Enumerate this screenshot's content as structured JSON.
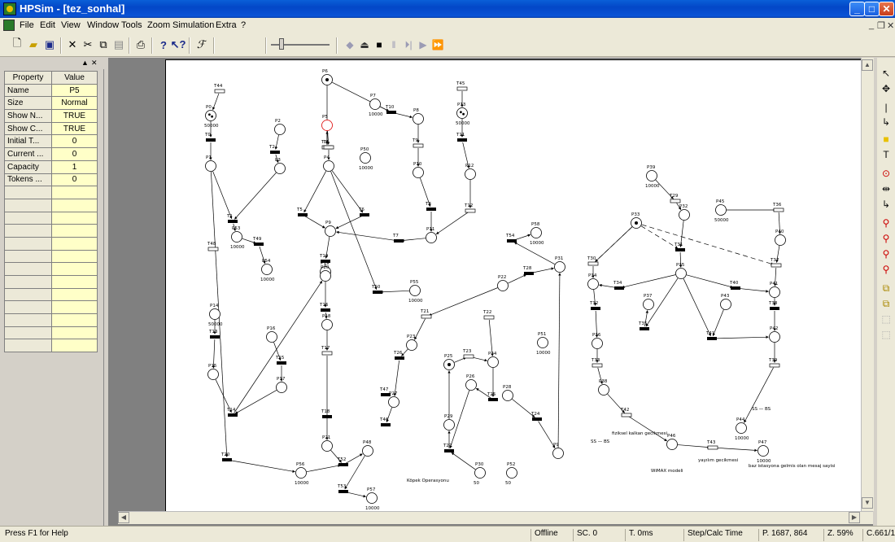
{
  "window": {
    "title": "HPSim - [tez_sonhal]"
  },
  "menu": {
    "items": [
      "File",
      "Edit",
      "View",
      "Window",
      "Tools",
      "Zoom",
      "Simulation",
      "Extra",
      "?"
    ]
  },
  "properties": {
    "col_property": "Property",
    "col_value": "Value",
    "rows": [
      {
        "name": "Name",
        "value": "P5"
      },
      {
        "name": "Size",
        "value": "Normal"
      },
      {
        "name": "Show N...",
        "value": "TRUE"
      },
      {
        "name": "Show C...",
        "value": "TRUE"
      },
      {
        "name": "Initial T...",
        "value": "0"
      },
      {
        "name": "Current ...",
        "value": "0"
      },
      {
        "name": "Capacity",
        "value": "1"
      },
      {
        "name": "Tokens ...",
        "value": "0"
      }
    ]
  },
  "net": {
    "places": [
      {
        "id": "P6",
        "tokens": 1,
        "label": "P6"
      },
      {
        "id": "P0",
        "label": "P0",
        "cap": "50000",
        "tokens": 2
      },
      {
        "id": "P1",
        "label": "P1"
      },
      {
        "id": "P2",
        "label": "P2"
      },
      {
        "id": "P3",
        "label": "P3"
      },
      {
        "id": "P4",
        "label": "P4"
      },
      {
        "id": "P5",
        "label": "P5",
        "selected": true
      },
      {
        "id": "P7",
        "label": "P7",
        "cap": "10000"
      },
      {
        "id": "P8",
        "label": "P8"
      },
      {
        "id": "P9",
        "label": "P9"
      },
      {
        "id": "P10",
        "label": "P10"
      },
      {
        "id": "P11",
        "label": "P11"
      },
      {
        "id": "P12",
        "label": "P12"
      },
      {
        "id": "P13",
        "label": "P13",
        "cap": "50000",
        "tokens": 2
      },
      {
        "id": "P50",
        "label": "P50",
        "cap": "10000"
      },
      {
        "id": "P53",
        "label": "P53",
        "cap": "10000"
      },
      {
        "id": "P54",
        "label": "P54",
        "cap": "10000"
      },
      {
        "id": "P55",
        "label": "P55",
        "cap": "10000"
      },
      {
        "id": "P58",
        "label": "P58",
        "cap": "10000"
      },
      {
        "id": "P19",
        "label": "P19"
      },
      {
        "id": "P20",
        "label": "P20"
      },
      {
        "id": "P14",
        "label": "P14",
        "cap": "50000"
      },
      {
        "id": "P15",
        "label": "P15"
      },
      {
        "id": "P16",
        "label": "P16"
      },
      {
        "id": "P17",
        "label": "P17"
      },
      {
        "id": "P18",
        "label": "P18"
      },
      {
        "id": "P21",
        "label": "P21"
      },
      {
        "id": "P22",
        "label": "P22"
      },
      {
        "id": "P31",
        "label": "P31"
      },
      {
        "id": "P23",
        "label": "P23"
      },
      {
        "id": "P25",
        "label": "P25",
        "tokens": 1
      },
      {
        "id": "P24",
        "label": "P24"
      },
      {
        "id": "P26",
        "label": "P26"
      },
      {
        "id": "P27",
        "label": "P27"
      },
      {
        "id": "P28",
        "label": "P28"
      },
      {
        "id": "P29",
        "label": "P29"
      },
      {
        "id": "P30",
        "label": "P30",
        "cap": "50"
      },
      {
        "id": "P51",
        "label": "P51",
        "cap": "10000"
      },
      {
        "id": "P52",
        "label": "P52",
        "cap": "50"
      },
      {
        "id": "P48",
        "label": "P48"
      },
      {
        "id": "P56",
        "label": "P56",
        "cap": "10000"
      },
      {
        "id": "P57",
        "label": "P57",
        "cap": "10000"
      },
      {
        "id": "P9b",
        "label": "P9"
      },
      {
        "id": "P33",
        "label": "P33",
        "tokens": 1
      },
      {
        "id": "P39",
        "label": "P39",
        "cap": "10000"
      },
      {
        "id": "P45",
        "label": "P45",
        "cap": "50000"
      },
      {
        "id": "P32",
        "label": "P32"
      },
      {
        "id": "P35",
        "label": "P35"
      },
      {
        "id": "P34",
        "label": "P34"
      },
      {
        "id": "P37",
        "label": "P37"
      },
      {
        "id": "P36",
        "label": "P36"
      },
      {
        "id": "P38",
        "label": "P38"
      },
      {
        "id": "P40",
        "label": "P40"
      },
      {
        "id": "P41",
        "label": "P41"
      },
      {
        "id": "P42",
        "label": "P42"
      },
      {
        "id": "P43",
        "label": "P43"
      },
      {
        "id": "P44",
        "label": "P44",
        "cap": "10000"
      },
      {
        "id": "P46",
        "label": "P46"
      },
      {
        "id": "P47",
        "label": "P47",
        "cap": "10000"
      }
    ],
    "transitions": [
      "T44",
      "T0",
      "T1",
      "T2",
      "T3",
      "T4",
      "T5",
      "T6",
      "T7",
      "T8",
      "T9",
      "T10",
      "T11",
      "T12",
      "T45",
      "T48",
      "T49",
      "T50",
      "T54",
      "T28",
      "T19",
      "T13",
      "T14",
      "T15",
      "T16",
      "T17",
      "T18",
      "T20",
      "T52",
      "T53",
      "T21",
      "T22",
      "T23",
      "T24",
      "T25",
      "T26",
      "T27",
      "T46",
      "T29",
      "T30",
      "T31",
      "T32",
      "T33",
      "T34",
      "T35",
      "T36",
      "T37",
      "T38",
      "T39",
      "T40",
      "T41",
      "T42",
      "T43",
      "T47"
    ],
    "annotations": {
      "kopek": "Köpek Operasyonu",
      "ss_bs_1": "SS — BS",
      "ss_bs_2": "SS — BS",
      "fiziksel": "fiziksel kalkan gecikmesi",
      "yayilim": "yayılım gecikmesi",
      "baz": "baz istasyona gelmis olan mesaj sayisi",
      "wimax": "WiMAX modeli"
    }
  },
  "status": {
    "help": "Press F1 for Help",
    "mode": "Offline",
    "sc": "SC. 0",
    "time": "T. 0ms",
    "step": "Step/Calc Time",
    "pos": "P. 1687, 864",
    "zoom": "Z. 59%",
    "coord": "C.661/1"
  }
}
